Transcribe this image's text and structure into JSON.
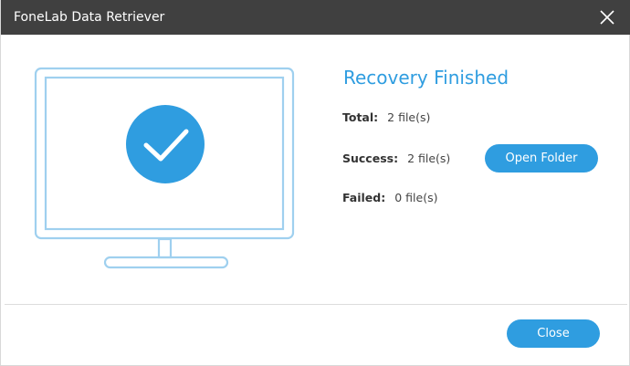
{
  "window": {
    "title": "FoneLab Data Retriever"
  },
  "result": {
    "heading": "Recovery Finished",
    "total_label": "Total:",
    "total_value": "2 file(s)",
    "success_label": "Success:",
    "success_value": "2 file(s)",
    "failed_label": "Failed:",
    "failed_value": "0 file(s)"
  },
  "buttons": {
    "open_folder": "Open Folder",
    "close": "Close"
  },
  "icons": {
    "close": "close-icon",
    "monitor": "monitor-icon",
    "check": "checkmark-icon"
  },
  "colors": {
    "titlebar": "#404040",
    "accent": "#2f9de0",
    "monitor_stroke": "#9fd0ef"
  }
}
